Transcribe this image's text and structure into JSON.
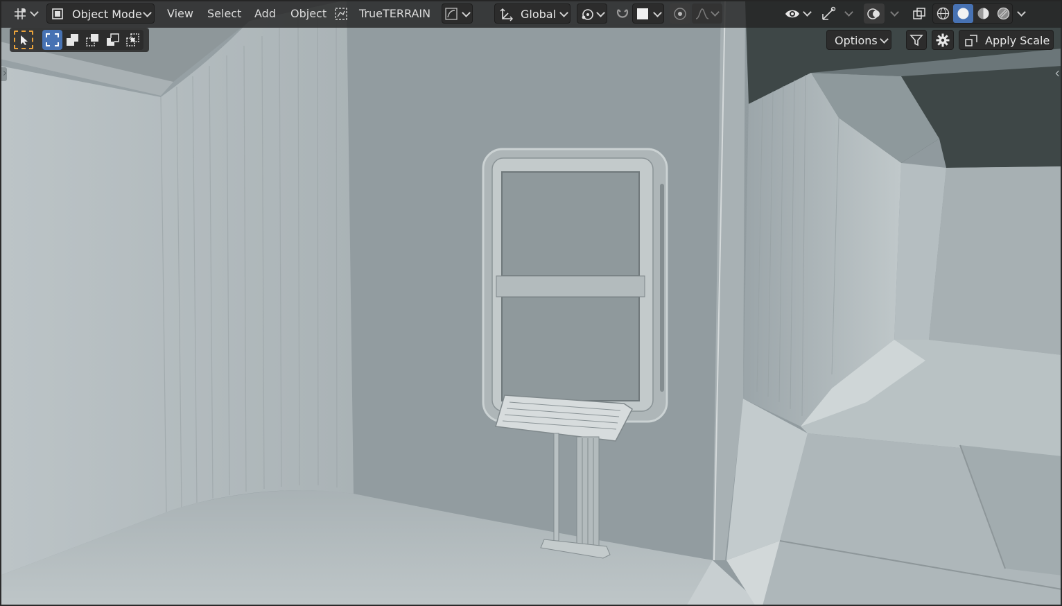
{
  "header": {
    "editor_type_icon": "grid-axes-icon",
    "mode_label": "Object Mode",
    "menus": [
      "View",
      "Select",
      "Add",
      "Object"
    ],
    "addon_label": "TrueTERRAIN",
    "orientation_label": "Global",
    "pivot_icon": "pivot-icon",
    "snap_icon": "magnet-icon",
    "proportional_icon": "proportional-edit-icon",
    "falloff_icon": "falloff-curve-icon",
    "visibility_icon": "eye-icon",
    "gizmo_icon": "gizmo-icon",
    "overlay_icon": "overlay-icon",
    "xray_icon": "xray-icon",
    "shading_modes": [
      "wireframe",
      "solid",
      "material-preview",
      "rendered"
    ],
    "active_shading": "solid"
  },
  "toolbar": {
    "tool_icon": "select-cursor-icon",
    "select_modes": [
      "new",
      "extend",
      "subtract",
      "invert",
      "intersect"
    ],
    "options_label": "Options",
    "filter_icon": "filter-icon",
    "settings_icon": "gear-icon",
    "apply_scale_label": "Apply Scale"
  },
  "colors": {
    "header_bg": "#242424",
    "accent_orange": "#e9a23b",
    "accent_blue": "#4772b3",
    "wall_light": "#b9c1c4",
    "wall_mid": "#9aa4a8",
    "ceiling_dark": "#3e4747"
  }
}
